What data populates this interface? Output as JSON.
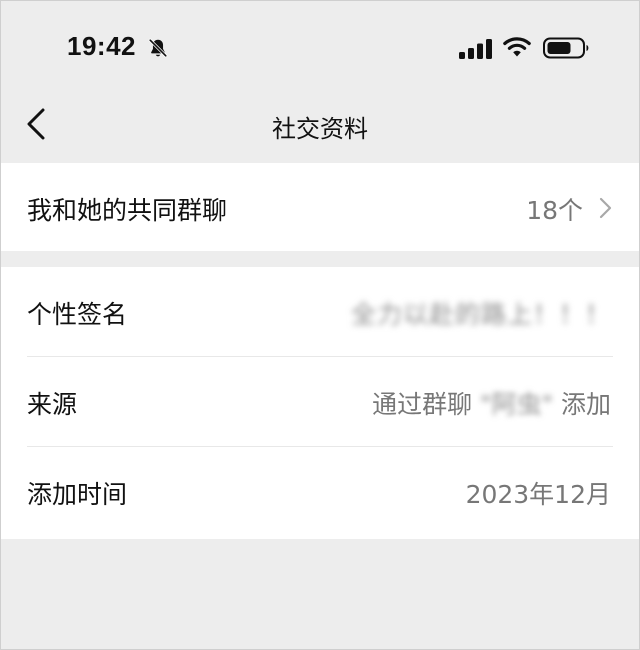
{
  "status_bar": {
    "time": "19:42",
    "icons": [
      "bell-off-icon",
      "signal-icon",
      "wifi-icon",
      "battery-icon"
    ]
  },
  "nav": {
    "back_icon": "chevron-left-icon",
    "title": "社交资料"
  },
  "groups_row": {
    "label": "我和她的共同群聊",
    "value": "18个",
    "icon": "chevron-right-icon"
  },
  "info": {
    "signature": {
      "label": "个性签名",
      "value": "全力以赴的路上！！！"
    },
    "source": {
      "label": "来源",
      "prefix": "通过群聊",
      "group_name": "\"阿虫\"",
      "suffix": "添加"
    },
    "added_time": {
      "label": "添加时间",
      "value": "2023年12月"
    }
  },
  "colors": {
    "background": "#ededed",
    "card": "#ffffff",
    "secondary_text": "#777777"
  }
}
